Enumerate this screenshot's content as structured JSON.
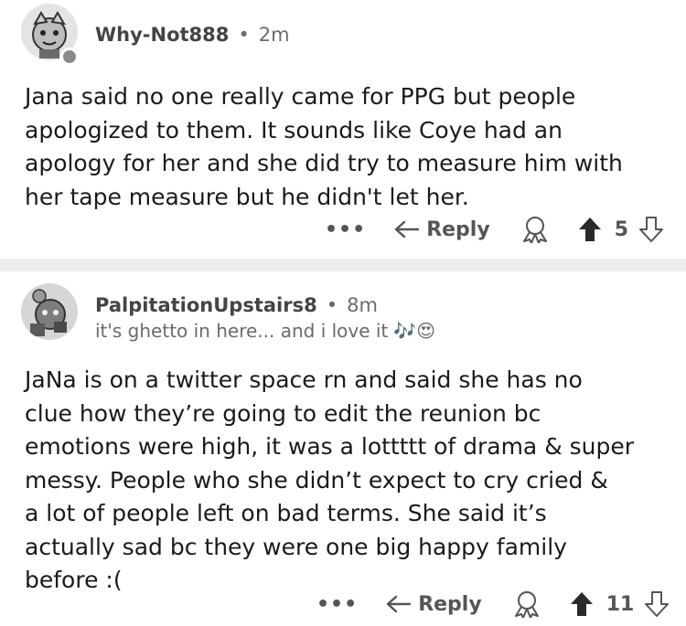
{
  "comments": [
    {
      "author": "Why-Not888",
      "age": "2m",
      "lines": [
        "Jana said no one really came for PPG but people",
        "apologized to them. It sounds like Coye had an",
        "apology for her and she did try to measure him with",
        "her tape measure but he didn't let her."
      ],
      "more_label": "•••",
      "reply_label": "Reply",
      "score": "5"
    },
    {
      "author": "PalpitationUpstairs8",
      "age": "8m",
      "flair": "it's ghetto in here... and i love it",
      "flair_emoji": "🎶😍",
      "lines": [
        "JaNa is on a twitter space rn and said she has no",
        "clue how they’re going to edit the reunion bc",
        "emotions were high, it was a lottttt of drama & super",
        "messy. People who she didn’t expect to cry cried &",
        "a lot of people left on bad terms. She said it’s",
        "actually sad bc they were one big happy family",
        "before :("
      ],
      "more_label": "•••",
      "reply_label": "Reply",
      "score": "11"
    }
  ],
  "separator": "•"
}
